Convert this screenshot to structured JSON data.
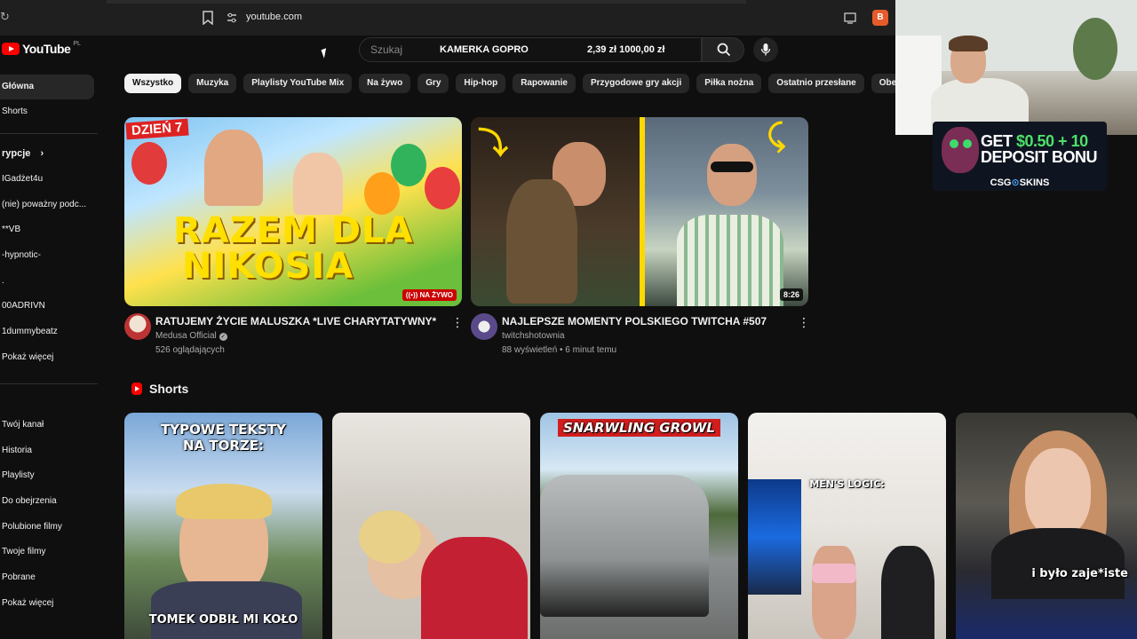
{
  "browser": {
    "url": "youtube.com"
  },
  "header": {
    "logo_text": "YouTube",
    "region": "PL",
    "search_placeholder": "Szukaj",
    "overlay_ad_text": "KAMERKA GOPRO",
    "overlay_price": "2,39 zł  1000,00 zł"
  },
  "sidebar": {
    "home": "Główna",
    "shorts": "Shorts",
    "subscriptions_heading": "rypcje",
    "subscriptions": [
      "IGadżet4u",
      "(nie) poważny podc...",
      "**VB",
      "-hypnotic-",
      ".",
      "00ADRIVN",
      "1dummybeatz",
      "Pokaż więcej"
    ],
    "you": [
      "Twój kanał",
      "Historia",
      "Playlisty",
      "Do obejrzenia",
      "Polubione filmy",
      "Twoje filmy",
      "Pobrane",
      "Pokaż więcej"
    ]
  },
  "chips": [
    "Wszystko",
    "Muzyka",
    "Playlisty YouTube Mix",
    "Na żywo",
    "Gry",
    "Hip-hop",
    "Rapowanie",
    "Przygodowe gry akcji",
    "Piłka nożna",
    "Ostatnio przesłane",
    "Obejrzane"
  ],
  "videos": [
    {
      "thumb_day": "DZIEŃ 7",
      "thumb_text_1": "RAZEM DLA",
      "thumb_text_2": "NIKOSIA",
      "badge": "NA ŻYWO",
      "title": "RATUJEMY ŻYCIE MALUSZKA *LIVE CHARYTATYWNY*",
      "channel": "Medusa Official",
      "stats": "526 oglądających"
    },
    {
      "duration": "8:26",
      "title": "NAJLEPSZE MOMENTY POLSKIEGO TWITCHA #507",
      "channel": "twitchshotownia",
      "stats": "88 wyświetleń • 6 minut temu"
    }
  ],
  "shorts": {
    "heading": "Shorts",
    "items": [
      {
        "top_text": "TYPOWE TEKSTY NA TORZE:",
        "bottom_text": "TOMEK ODBIŁ MI KOŁO"
      },
      {
        "top_text": "",
        "bottom_text": ""
      },
      {
        "top_text": "SNARWLING GROWL",
        "bottom_text": ""
      },
      {
        "top_text": "MEN'S LOGIC:",
        "bottom_text": ""
      },
      {
        "top_text": "",
        "bottom_text": "i było zaje*iste"
      }
    ]
  },
  "ad": {
    "line1_prefix": "GET ",
    "line1_amount": "$0.50 + 10",
    "line2": "DEPOSIT BONU",
    "brand_prefix": "CSG",
    "brand_o": "⊙",
    "brand_suffix": "SKINS"
  },
  "colors": {
    "accent": "#ff0000",
    "background": "#0f0f0f",
    "chip": "#272727"
  }
}
